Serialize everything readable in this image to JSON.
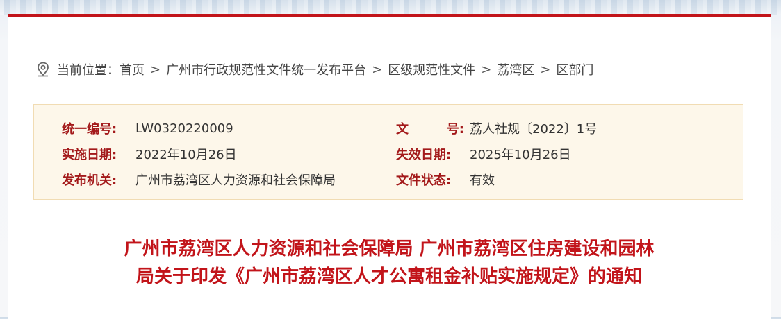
{
  "breadcrumb": {
    "prefix": "当前位置：",
    "items": [
      "首页",
      "广州市行政规范性文件统一发布平台",
      "区级规范性文件",
      "荔湾区",
      "区部门"
    ],
    "separator": ">"
  },
  "meta": {
    "code_label": "统一编号:",
    "code_value": "LW0320220009",
    "docno_label_a": "文",
    "docno_label_b": "号:",
    "docno_value": "荔人社规〔2022〕1号",
    "effective_label": "实施日期:",
    "effective_value": "2022年10月26日",
    "expire_label": "失效日期:",
    "expire_value": "2025年10月26日",
    "issuer_label": "发布机关:",
    "issuer_value": "广州市荔湾区人力资源和社会保障局",
    "status_label": "文件状态:",
    "status_value": "有效"
  },
  "title": {
    "line1": "广州市荔湾区人力资源和社会保障局 广州市荔湾区住房建设和园林",
    "line2": "局关于印发《广州市荔湾区人才公寓租金补贴实施规定》的通知"
  },
  "colors": {
    "accent": "#c2141a",
    "label": "#a3191a",
    "meta_bg": "#fdf7ea"
  },
  "icons": {
    "location": "location-pin-icon"
  }
}
